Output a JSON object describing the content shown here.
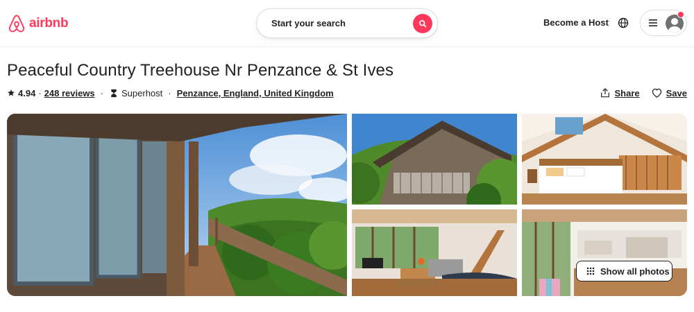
{
  "brand": {
    "name": "airbnb",
    "color": "#FF385C"
  },
  "header": {
    "search_label": "Start your search",
    "host_link": "Become a Host",
    "icons": [
      "search-icon",
      "globe-icon",
      "hamburger-icon",
      "user-avatar-icon"
    ]
  },
  "listing": {
    "title": "Peaceful Country Treehouse Nr Penzance & St Ives",
    "rating": "4.94",
    "separator": "·",
    "reviews": "248 reviews",
    "superhost": "Superhost",
    "location": "Penzance, England, United Kingdom",
    "share": "Share",
    "save": "Save"
  },
  "gallery": {
    "show_all": "Show all photos"
  }
}
